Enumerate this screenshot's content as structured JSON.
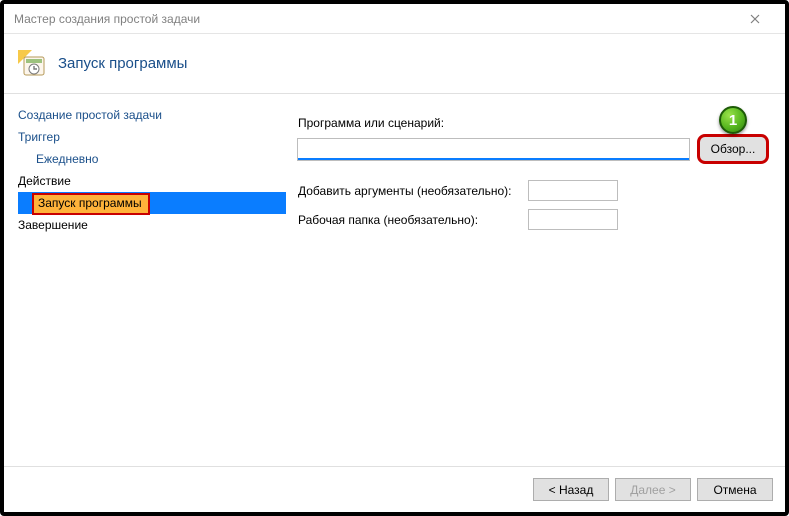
{
  "window": {
    "title": "Мастер создания простой задачи"
  },
  "header": {
    "title": "Запуск программы"
  },
  "sidebar": {
    "items": [
      {
        "label": "Создание простой задачи"
      },
      {
        "label": "Триггер"
      },
      {
        "label": "Ежедневно"
      },
      {
        "label": "Действие"
      },
      {
        "label": "Запуск программы"
      },
      {
        "label": "Завершение"
      }
    ]
  },
  "form": {
    "program_label": "Программа или сценарий:",
    "program_value": "",
    "browse_label": "Обзор...",
    "arguments_label": "Добавить аргументы (необязательно):",
    "arguments_value": "",
    "startin_label": "Рабочая папка (необязательно):",
    "startin_value": ""
  },
  "footer": {
    "back": "< Назад",
    "next": "Далее >",
    "cancel": "Отмена"
  },
  "annotation": {
    "badge": "1"
  }
}
